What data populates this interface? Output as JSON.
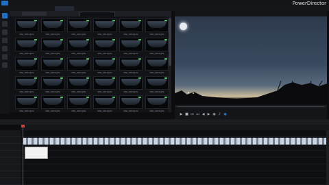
{
  "app": {
    "brand": "PowerDirector",
    "title": ""
  },
  "menu": [
    "",
    "",
    "",
    "",
    "",
    ""
  ],
  "tabs": [
    {
      "label": "",
      "active": false
    },
    {
      "label": "",
      "active": false
    },
    {
      "label": "",
      "active": true
    },
    {
      "label": "",
      "active": false
    },
    {
      "label": "",
      "active": false
    }
  ],
  "library": {
    "search_placeholder": "",
    "filter_label": "",
    "thumb_caption": "IMG_0001.JPG",
    "columns": 6,
    "rows": 5
  },
  "preview": {
    "timecode": ""
  },
  "timeline": {
    "toolbar": [
      "",
      "",
      "",
      "",
      "",
      "",
      ""
    ],
    "tooltip_lines": [
      "",
      "",
      "",
      ""
    ]
  },
  "colors": {
    "accent": "#1f6fc5",
    "selected_check": "#3fbf54",
    "playhead": "#d43c3c"
  }
}
